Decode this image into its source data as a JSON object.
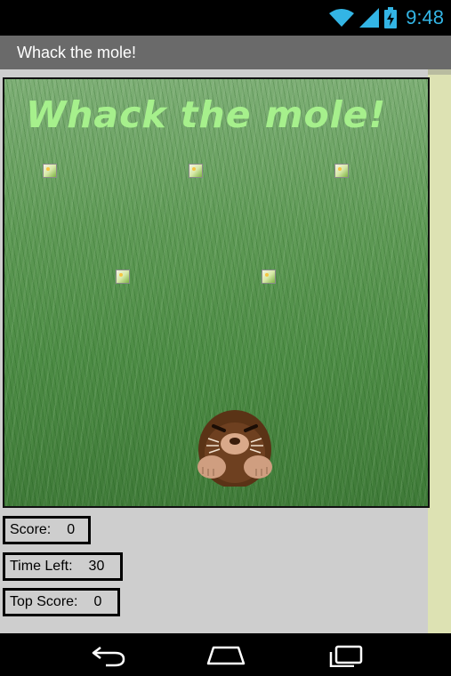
{
  "status_bar": {
    "time": "9:48",
    "icons": [
      "wifi-icon",
      "signal-icon",
      "battery-charging-icon"
    ],
    "accent_color": "#33b5e5"
  },
  "app_bar": {
    "title": "Whack the mole!"
  },
  "canvas": {
    "heading": "Whack the mole!",
    "holes": [
      "broken-image-icon",
      "broken-image-icon",
      "broken-image-icon",
      "broken-image-icon",
      "broken-image-icon"
    ],
    "sprite": "mole"
  },
  "stats": {
    "score_label": "Score:",
    "score_value": "0",
    "time_label": "Time Left:",
    "time_value": "30",
    "top_label": "Top Score:",
    "top_value": "0"
  },
  "nav_bar": {
    "buttons": [
      "back-icon",
      "home-icon",
      "recents-icon"
    ]
  }
}
